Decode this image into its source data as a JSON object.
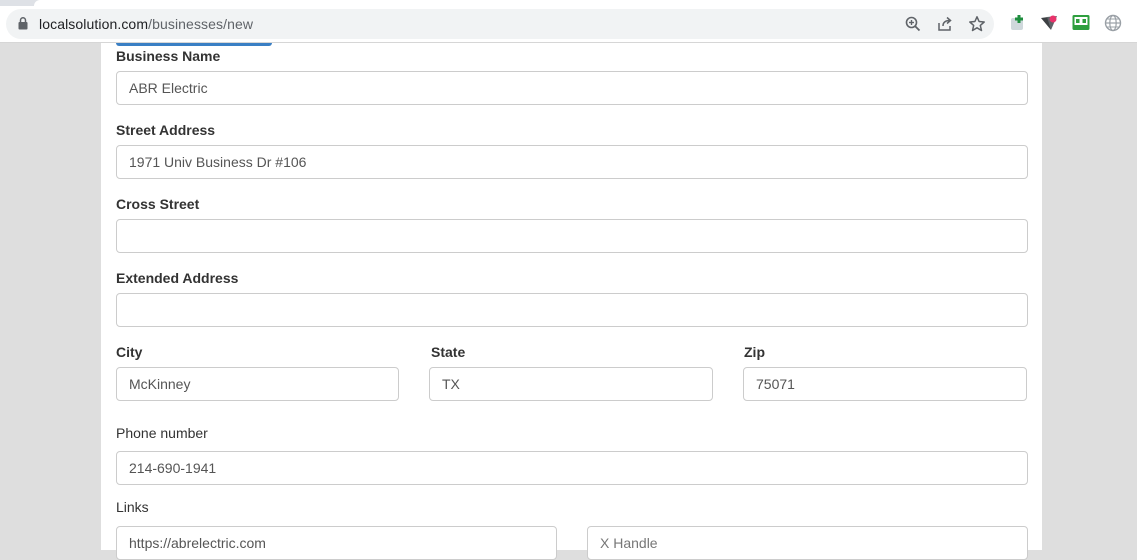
{
  "browser": {
    "url_host": "localsolution.com",
    "url_path": "/businesses/new",
    "icons": [
      "lock-icon",
      "zoom-icon",
      "share-icon",
      "bookmark-star-icon",
      "extension-add-icon",
      "extension-flag-icon",
      "extension-green-icon",
      "globe-icon"
    ]
  },
  "form": {
    "business_name": {
      "label": "Business Name",
      "value": "ABR Electric"
    },
    "street_address": {
      "label": "Street Address",
      "value": "1971 Univ Business Dr #106"
    },
    "cross_street": {
      "label": "Cross Street",
      "value": ""
    },
    "extended_address": {
      "label": "Extended Address",
      "value": ""
    },
    "city": {
      "label": "City",
      "value": "McKinney"
    },
    "state": {
      "label": "State",
      "value": "TX"
    },
    "zip": {
      "label": "Zip",
      "value": "75071"
    },
    "phone": {
      "label": "Phone number",
      "value": "214-690-1941"
    },
    "links": {
      "label": "Links",
      "website": "https://abrelectric.com",
      "x_handle_placeholder": "X Handle"
    }
  },
  "colors": {
    "page_background": "#dedede",
    "panel": "#ffffff",
    "accent_button": "#3a7fc4",
    "input_border": "#cccccc"
  }
}
